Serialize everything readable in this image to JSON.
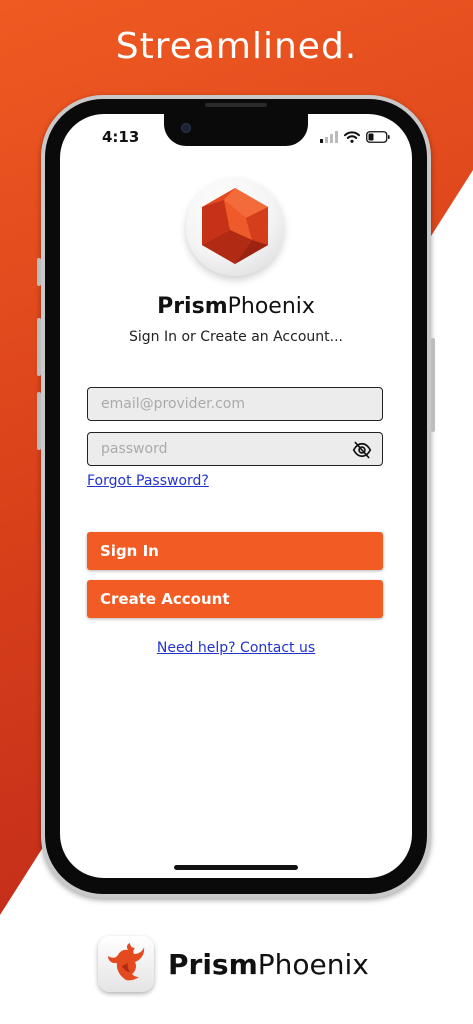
{
  "marketing": {
    "headline": "Streamlined."
  },
  "status_bar": {
    "time": "4:13",
    "icons": [
      "cellular-signal-icon",
      "wifi-icon",
      "battery-icon"
    ]
  },
  "app": {
    "logo_icon": "hexagon-gem-icon",
    "brand_bold": "Prism",
    "brand_regular": "Phoenix",
    "subtitle": "Sign In or Create an Account...",
    "email": {
      "value": "",
      "placeholder": "email@provider.com"
    },
    "password": {
      "value": "",
      "placeholder": "password",
      "toggle_icon": "eye-off-icon"
    },
    "forgot_password": "Forgot Password?",
    "sign_in": "Sign In",
    "create_account": "Create Account",
    "help_link": "Need help? Contact us"
  },
  "footer": {
    "icon": "phoenix-bird-icon",
    "brand_bold": "Prism",
    "brand_regular": "Phoenix"
  },
  "colors": {
    "accent": "#f25c24",
    "background_red": "#d8401a",
    "link": "#2233cc"
  }
}
